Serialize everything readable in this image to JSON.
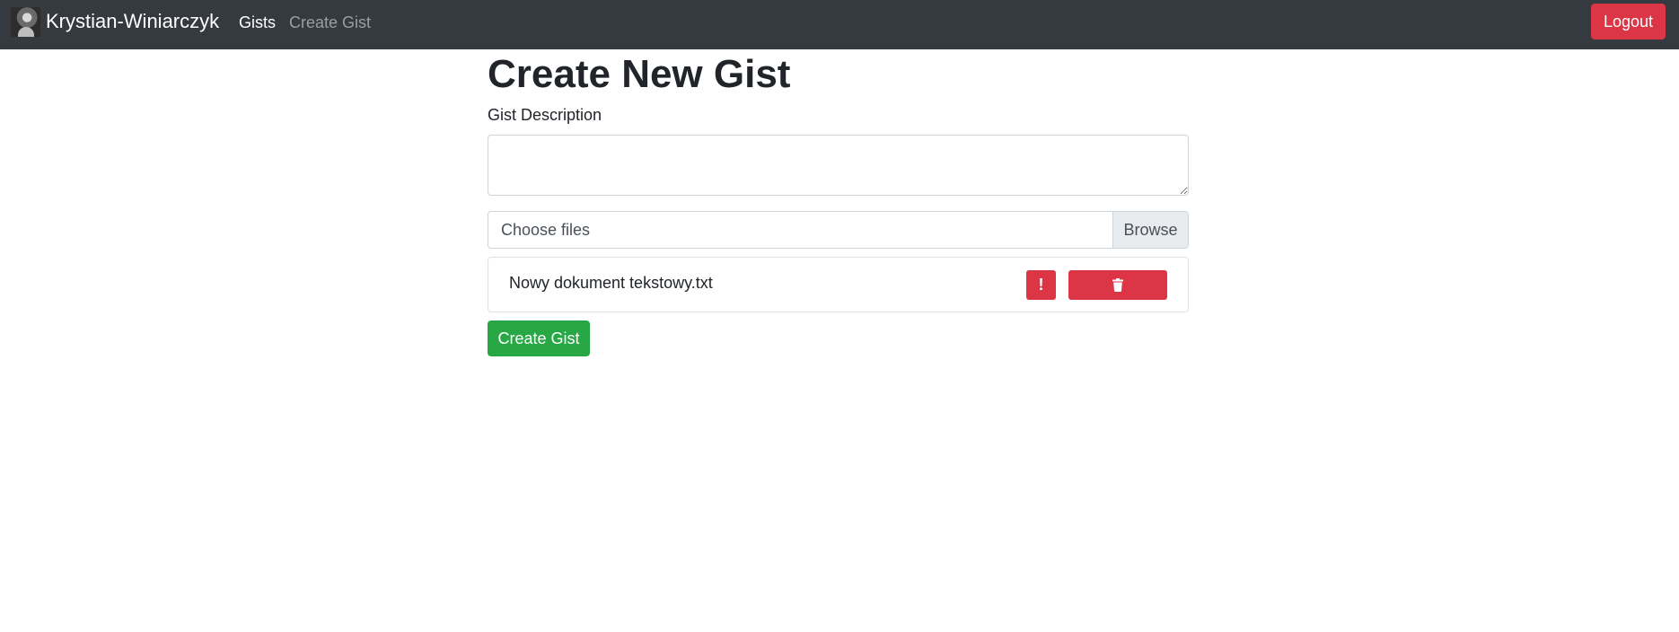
{
  "navbar": {
    "brand": "Krystian-Winiarczyk",
    "links": [
      "Gists",
      "Create Gist"
    ],
    "logout_label": "Logout"
  },
  "main": {
    "title": "Create New Gist",
    "description_label": "Gist Description",
    "description_value": "",
    "file_input": {
      "placeholder": "Choose files",
      "browse_label": "Browse"
    },
    "files": [
      {
        "name": "Nowy dokument tekstowy.txt"
      }
    ],
    "warning_icon_glyph": "!",
    "create_button_label": "Create Gist"
  },
  "colors": {
    "navbar_bg": "#343a40",
    "danger": "#dc3545",
    "success": "#28a745"
  },
  "icons": {
    "avatar": "user-avatar",
    "warning": "exclamation-icon",
    "delete": "trash-icon"
  }
}
